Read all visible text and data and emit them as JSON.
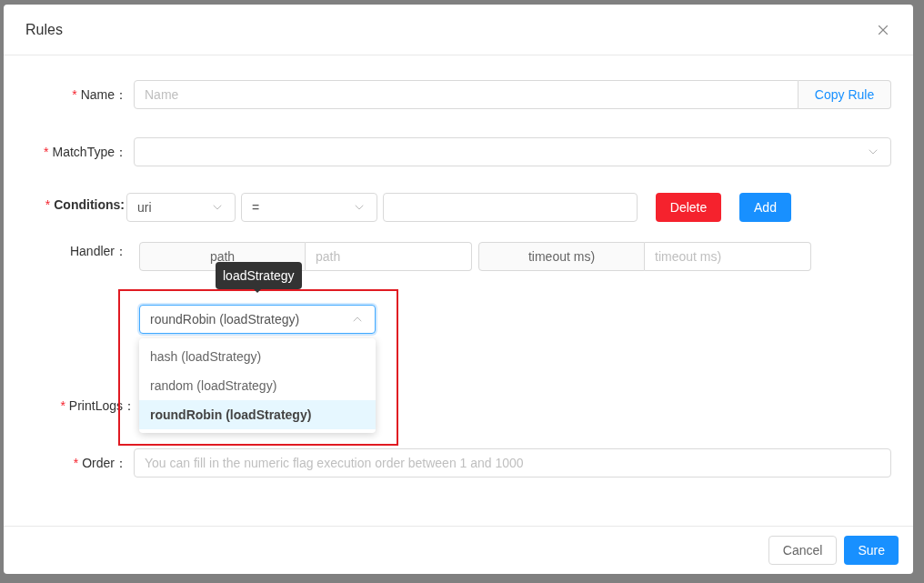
{
  "dialog": {
    "title": "Rules"
  },
  "name": {
    "mark": "*",
    "label": "Name：",
    "placeholder": "Name",
    "button": "Copy Rule"
  },
  "match_type": {
    "mark": "*",
    "label": "MatchType："
  },
  "conditions": {
    "mark": "*",
    "label": "Conditions:",
    "param_type": "uri",
    "operator": "=",
    "delete": "Delete",
    "add": "Add"
  },
  "handler": {
    "label": "Handler：",
    "groups": [
      {
        "addon": "path",
        "placeholder": "path"
      },
      {
        "addon": "timeout ms)",
        "placeholder": "timeout ms)"
      }
    ]
  },
  "load_strategy": {
    "tooltip": "loadStrategy",
    "value": "roundRobin (loadStrategy)",
    "expanded": true,
    "options": [
      {
        "label": "hash (loadStrategy)",
        "selected": false
      },
      {
        "label": "random (loadStrategy)",
        "selected": false
      },
      {
        "label": "roundRobin (loadStrategy)",
        "selected": true
      }
    ]
  },
  "print_logs": {
    "mark": "*",
    "label": "PrintLogs："
  },
  "order": {
    "mark": "*",
    "label": "Order：",
    "placeholder": "You can fill in the numeric flag execution order between 1 and 1000"
  },
  "footer": {
    "buttons": [
      {
        "label": "Cancel",
        "kind": "default"
      },
      {
        "label": "Sure",
        "kind": "primary"
      }
    ]
  }
}
